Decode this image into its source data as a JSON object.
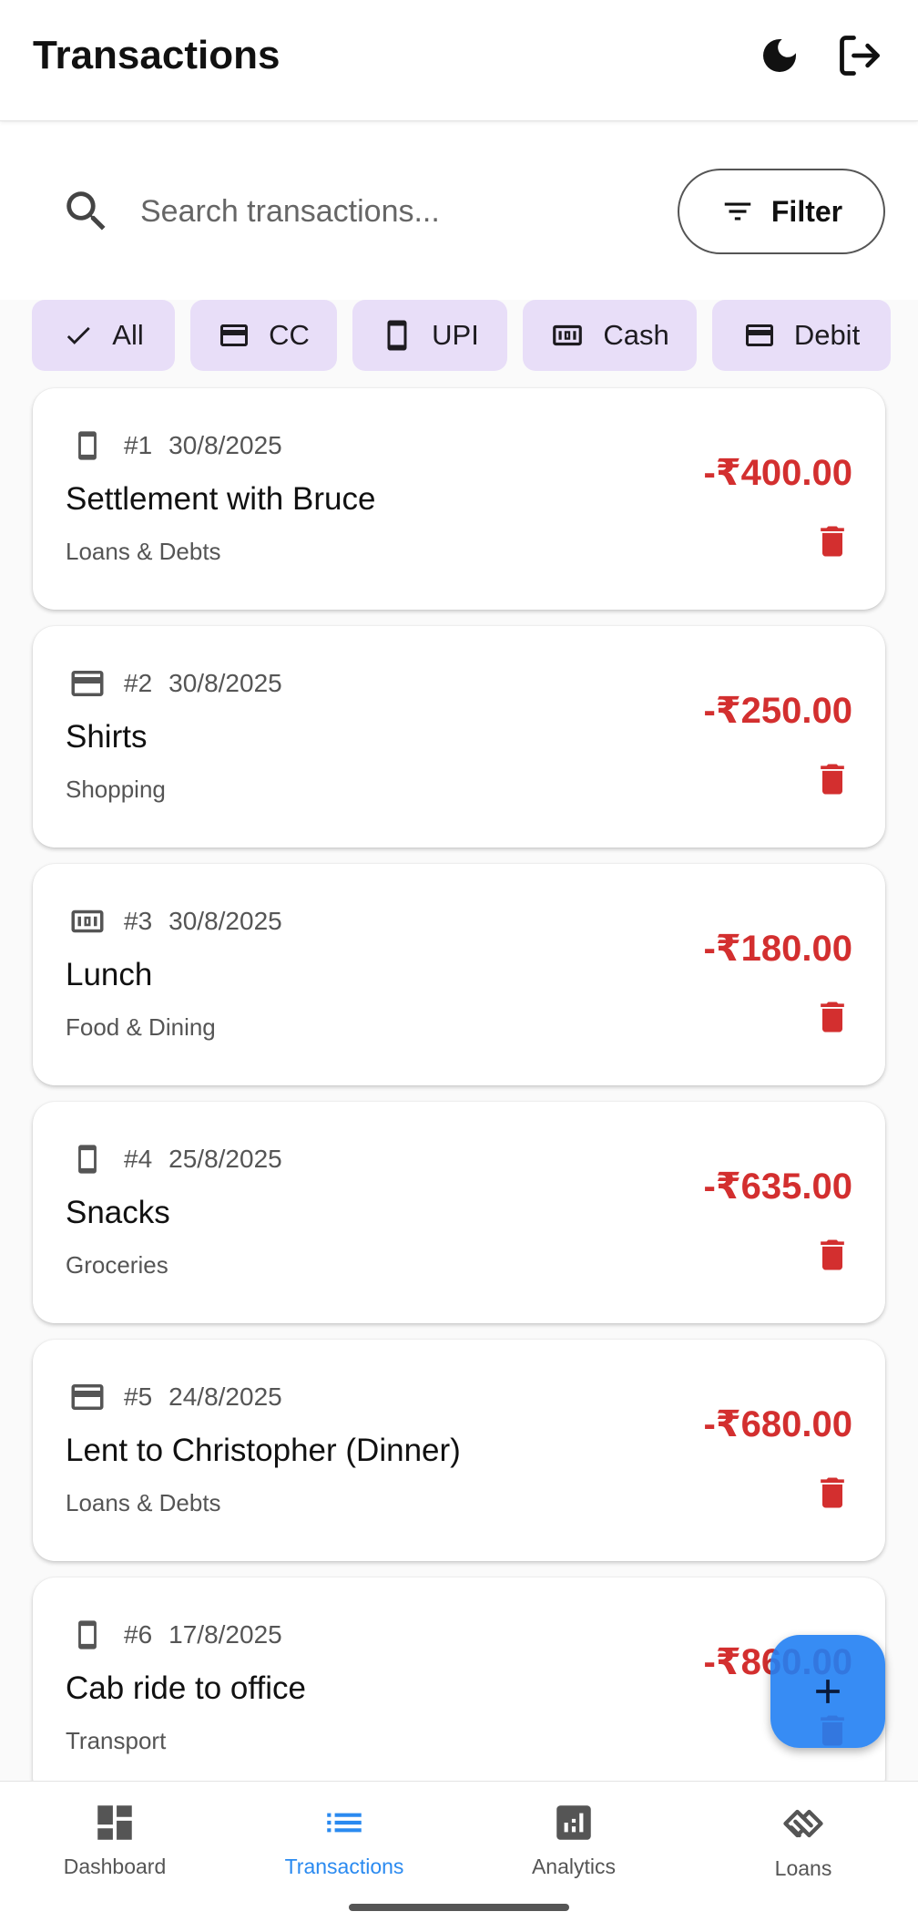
{
  "header": {
    "title": "Transactions",
    "theme_icon": "moon-icon",
    "logout_icon": "logout-icon"
  },
  "search": {
    "placeholder": "Search transactions...",
    "value": "",
    "filter_label": "Filter"
  },
  "chips": [
    {
      "label": "All",
      "icon": "check-icon",
      "selected": true
    },
    {
      "label": "CC",
      "icon": "credit-card-icon"
    },
    {
      "label": "UPI",
      "icon": "smartphone-icon"
    },
    {
      "label": "Cash",
      "icon": "cash-icon"
    },
    {
      "label": "Debit",
      "icon": "credit-card-icon"
    }
  ],
  "transactions": [
    {
      "num": "#1",
      "date": "30/8/2025",
      "title": "Settlement with Bruce",
      "category": "Loans & Debts",
      "amount": "-₹400.00",
      "method": "smartphone-icon"
    },
    {
      "num": "#2",
      "date": "30/8/2025",
      "title": "Shirts",
      "category": "Shopping",
      "amount": "-₹250.00",
      "method": "credit-card-icon"
    },
    {
      "num": "#3",
      "date": "30/8/2025",
      "title": "Lunch",
      "category": "Food & Dining",
      "amount": "-₹180.00",
      "method": "cash-icon"
    },
    {
      "num": "#4",
      "date": "25/8/2025",
      "title": "Snacks",
      "category": "Groceries",
      "amount": "-₹635.00",
      "method": "smartphone-icon"
    },
    {
      "num": "#5",
      "date": "24/8/2025",
      "title": "Lent to Christopher (Dinner)",
      "category": "Loans & Debts",
      "amount": "-₹680.00",
      "method": "credit-card-icon"
    },
    {
      "num": "#6",
      "date": "17/8/2025",
      "title": "Cab ride to office",
      "category": "Transport",
      "amount": "-₹860.00",
      "method": "smartphone-icon"
    }
  ],
  "fab": {
    "icon": "plus-icon"
  },
  "nav": [
    {
      "label": "Dashboard",
      "icon": "dashboard-icon"
    },
    {
      "label": "Transactions",
      "icon": "list-icon",
      "active": true
    },
    {
      "label": "Analytics",
      "icon": "analytics-icon"
    },
    {
      "label": "Loans",
      "icon": "handshake-icon"
    }
  ],
  "colors": {
    "expense": "#d32f2f",
    "chip_bg": "#e8def8",
    "fab": "#2a82f2",
    "nav_active": "#2a8af0"
  }
}
